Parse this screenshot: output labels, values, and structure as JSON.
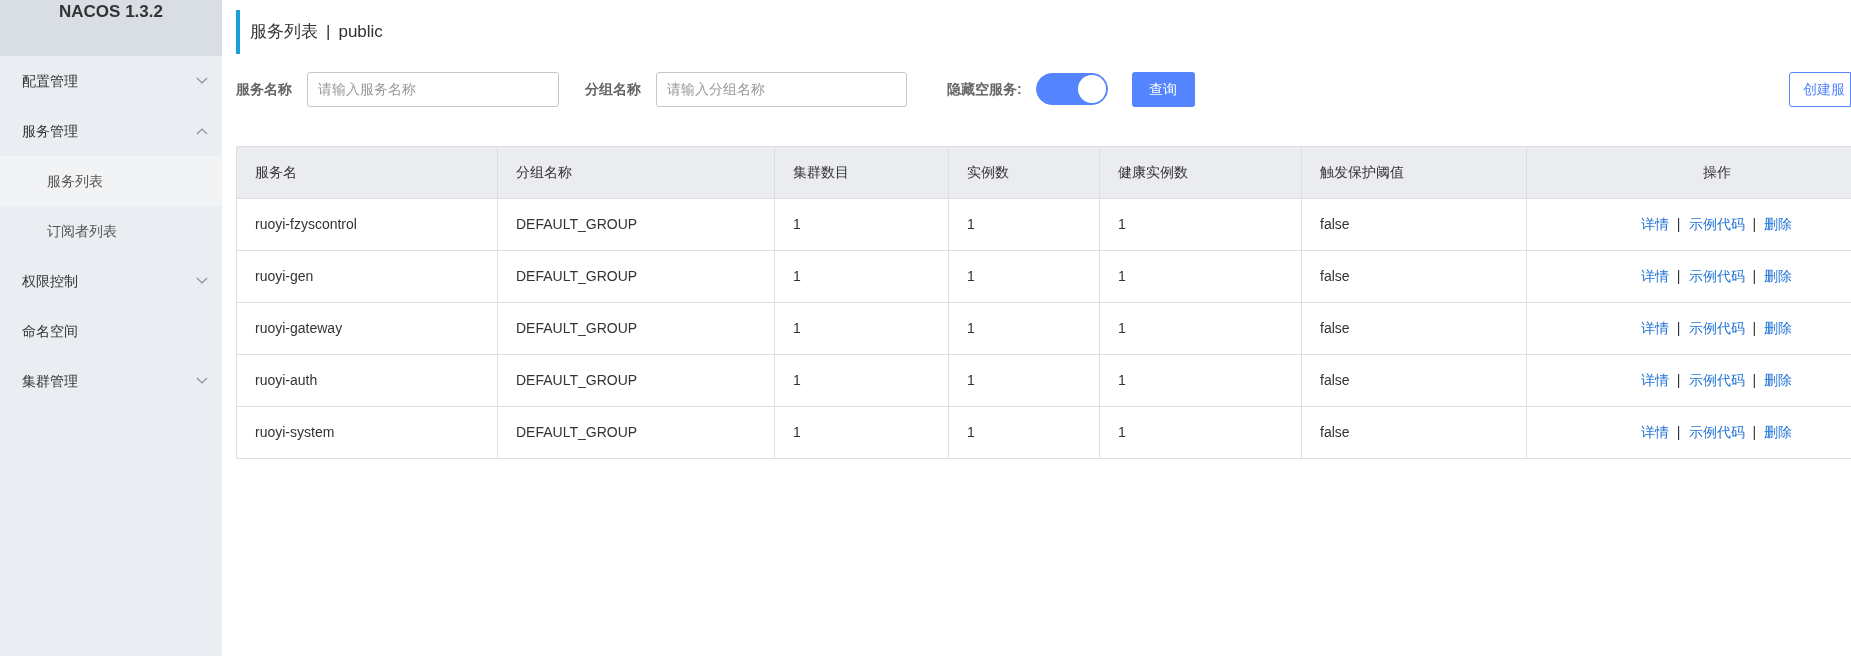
{
  "sidebar": {
    "title": "NACOS 1.3.2",
    "items": [
      {
        "label": "配置管理",
        "expanded": false
      },
      {
        "label": "服务管理",
        "expanded": true,
        "children": [
          {
            "label": "服务列表",
            "selected": true
          },
          {
            "label": "订阅者列表",
            "selected": false
          }
        ]
      },
      {
        "label": "权限控制",
        "expanded": false
      },
      {
        "label": "命名空间"
      },
      {
        "label": "集群管理",
        "expanded": false
      }
    ]
  },
  "page_title": {
    "section": "服务列表",
    "separator": "|",
    "namespace": "public"
  },
  "filters": {
    "service_name": {
      "label": "服务名称",
      "placeholder": "请输入服务名称"
    },
    "group_name": {
      "label": "分组名称",
      "placeholder": "请输入分组名称"
    },
    "hide_empty": {
      "label": "隐藏空服务:",
      "on": true
    },
    "query_button": "查询",
    "create_button": "创建服"
  },
  "table": {
    "columns": [
      "服务名",
      "分组名称",
      "集群数目",
      "实例数",
      "健康实例数",
      "触发保护阈值",
      "操作"
    ],
    "rows": [
      {
        "cells": [
          "ruoyi-fzyscontrol",
          "DEFAULT_GROUP",
          "1",
          "1",
          "1",
          "false"
        ],
        "actions": [
          {
            "kind": "link",
            "text": "详情"
          },
          {
            "kind": "separator",
            "text": "|"
          },
          {
            "kind": "link",
            "text": "示例代码"
          },
          {
            "kind": "separator",
            "text": "|"
          },
          {
            "kind": "link",
            "text": "删除"
          }
        ]
      },
      {
        "cells": [
          "ruoyi-gen",
          "DEFAULT_GROUP",
          "1",
          "1",
          "1",
          "false"
        ],
        "actions": [
          {
            "kind": "link",
            "text": "详情"
          },
          {
            "kind": "separator",
            "text": "|"
          },
          {
            "kind": "link",
            "text": "示例代码"
          },
          {
            "kind": "separator",
            "text": "|"
          },
          {
            "kind": "link",
            "text": "删除"
          }
        ]
      },
      {
        "cells": [
          "ruoyi-gateway",
          "DEFAULT_GROUP",
          "1",
          "1",
          "1",
          "false"
        ],
        "actions": [
          {
            "kind": "link",
            "text": "详情"
          },
          {
            "kind": "separator",
            "text": "|"
          },
          {
            "kind": "link",
            "text": "示例代码"
          },
          {
            "kind": "separator",
            "text": "|"
          },
          {
            "kind": "link",
            "text": "删除"
          }
        ]
      },
      {
        "cells": [
          "ruoyi-auth",
          "DEFAULT_GROUP",
          "1",
          "1",
          "1",
          "false"
        ],
        "actions": [
          {
            "kind": "link",
            "text": "详情"
          },
          {
            "kind": "separator",
            "text": "|"
          },
          {
            "kind": "link",
            "text": "示例代码"
          },
          {
            "kind": "separator",
            "text": "|"
          },
          {
            "kind": "link",
            "text": "删除"
          }
        ]
      },
      {
        "cells": [
          "ruoyi-system",
          "DEFAULT_GROUP",
          "1",
          "1",
          "1",
          "false"
        ],
        "actions": [
          {
            "kind": "link",
            "text": "详情"
          },
          {
            "kind": "separator",
            "text": "|"
          },
          {
            "kind": "link",
            "text": "示例代码"
          },
          {
            "kind": "separator",
            "text": "|"
          },
          {
            "kind": "link",
            "text": "删除"
          }
        ]
      }
    ]
  }
}
